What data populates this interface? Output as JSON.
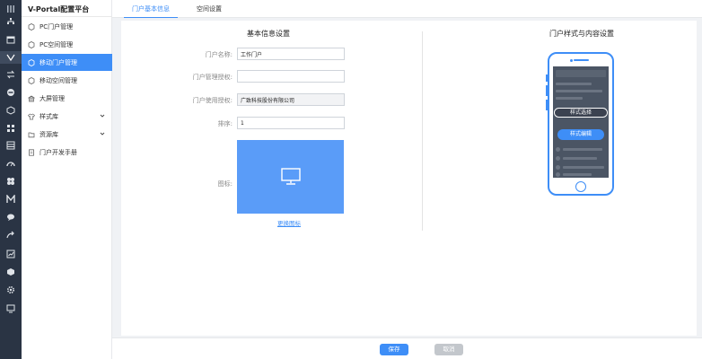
{
  "app": {
    "title": "V-Portal配置平台"
  },
  "rail": {
    "icons": [
      "menu-icon",
      "org-chart-icon",
      "calendar-icon",
      "portal-icon",
      "transfer-icon",
      "api-icon",
      "cube-icon",
      "grid-icon",
      "list-icon",
      "dashboard-icon",
      "fan-icon",
      "mail-icon",
      "chat-icon",
      "share-icon",
      "chart-icon",
      "box-icon",
      "settings-icon",
      "monitor-icon"
    ]
  },
  "sidebar": {
    "items": [
      {
        "label": "PC门户管理"
      },
      {
        "label": "PC空间管理"
      },
      {
        "label": "移动门户管理"
      },
      {
        "label": "移动空间管理"
      },
      {
        "label": "大屏管理"
      },
      {
        "label": "样式库"
      },
      {
        "label": "资源库"
      },
      {
        "label": "门户开发手册"
      }
    ]
  },
  "tabs": [
    {
      "label": "门户基本信息"
    },
    {
      "label": "空间设置"
    }
  ],
  "basic": {
    "title": "基本信息设置",
    "name_label": "门户名称:",
    "name_value": "工作门户",
    "manage_label": "门户管理授权:",
    "manage_value": "",
    "use_label": "门户使用授权:",
    "use_value": "广致科技股份有限公司",
    "sort_label": "排序:",
    "sort_value": "1",
    "icon_label": "图标:",
    "change_icon": "更换图标"
  },
  "style": {
    "title": "门户样式与内容设置",
    "select_label": "样式选择",
    "edit_label": "样式编辑"
  },
  "footer": {
    "save": "保存",
    "cancel": "取消"
  },
  "colors": {
    "accent": "#3e8ef7",
    "rail": "#2a3444"
  }
}
